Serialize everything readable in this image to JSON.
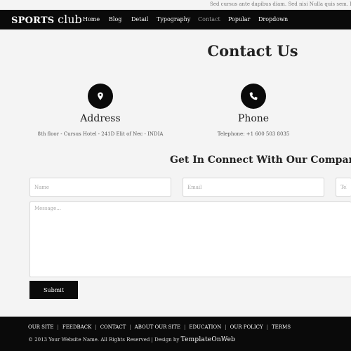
{
  "topbar": {
    "ticker": "Sed cursus ante dapibus diam. Sed nisi Nulla quis sem. Interdum"
  },
  "brand": {
    "bold": "SPORTS",
    "light": "club"
  },
  "nav": [
    {
      "label": "Home",
      "active": false
    },
    {
      "label": "Blog",
      "active": false
    },
    {
      "label": "Detail",
      "active": false
    },
    {
      "label": "Typography",
      "active": false
    },
    {
      "label": "Contact",
      "active": true
    },
    {
      "label": "Popular",
      "active": false
    },
    {
      "label": "Dropdown",
      "active": false
    }
  ],
  "page_title": "Contact Us",
  "info": {
    "address": {
      "icon": "map-pin-icon",
      "title": "Address",
      "text": "8th floor - Cursus Hotel - 241D Elit of Nec - INDIA"
    },
    "phone": {
      "icon": "phone-icon",
      "title": "Phone",
      "text": "Telephone: +1 600 503 8035"
    }
  },
  "form": {
    "title": "Get In Connect With Our Company",
    "name_placeholder": "Name",
    "email_placeholder": "Email",
    "telephone_placeholder": "Telephone",
    "message_placeholder": "Message...",
    "submit_label": "Submit"
  },
  "footer": {
    "links": [
      "OUR SITE",
      "FEEDBACK",
      "CONTACT",
      "ABOUT OUR SITE",
      "EDUCATION",
      "OUR POLICY",
      "TERMS"
    ],
    "separator": "|",
    "copyright": "© 2013 Your Website Name. All Rights Reserved | Design by",
    "credit": "TemplateOnWeb"
  },
  "colors": {
    "dark": "#0a0a0a",
    "background": "#f4f4f4",
    "nav_active": "#9a9a9a"
  }
}
